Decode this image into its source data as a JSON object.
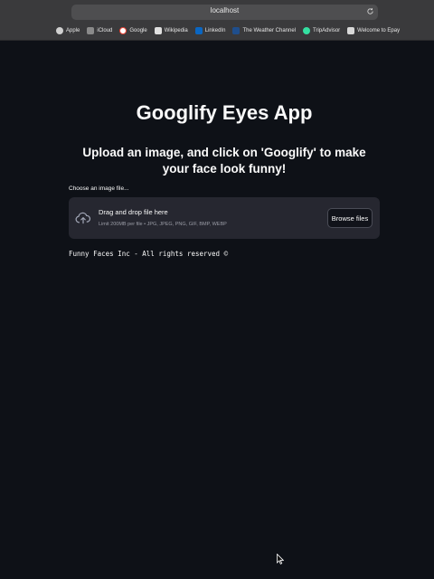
{
  "browser": {
    "url": "localhost",
    "bookmarks": [
      {
        "label": "Apple",
        "icon": "apple-icon",
        "color": "#d0d0d0"
      },
      {
        "label": "iCloud",
        "icon": "icloud-icon",
        "color": "#8a8a8a"
      },
      {
        "label": "Google",
        "icon": "google-icon",
        "color": "#ffffff"
      },
      {
        "label": "Wikipedia",
        "icon": "wikipedia-icon",
        "color": "#e0e0e0"
      },
      {
        "label": "LinkedIn",
        "icon": "linkedin-icon",
        "color": "#0a66c2"
      },
      {
        "label": "The Weather Channel",
        "icon": "weather-channel-icon",
        "color": "#1f4e8c"
      },
      {
        "label": "TripAdvisor",
        "icon": "tripadvisor-icon",
        "color": "#34e0a1"
      },
      {
        "label": "Welcome to Epay",
        "icon": "epay-icon",
        "color": "#d8d8d8"
      }
    ]
  },
  "page": {
    "title": "Googlify Eyes App",
    "subtitle": "Upload an image, and click on 'Googlify' to make your face look funny!",
    "uploader": {
      "label": "Choose an image file...",
      "drop_text": "Drag and drop file here",
      "limit_text": "Limit 200MB per file • JPG, JPEG, PNG, GIF, BMP, WEBP",
      "browse_label": "Browse files"
    },
    "footer": "Funny Faces Inc - All rights reserved ©"
  },
  "colors": {
    "background": "#0e1117",
    "dropzone": "#262730",
    "text": "#fafafa"
  }
}
